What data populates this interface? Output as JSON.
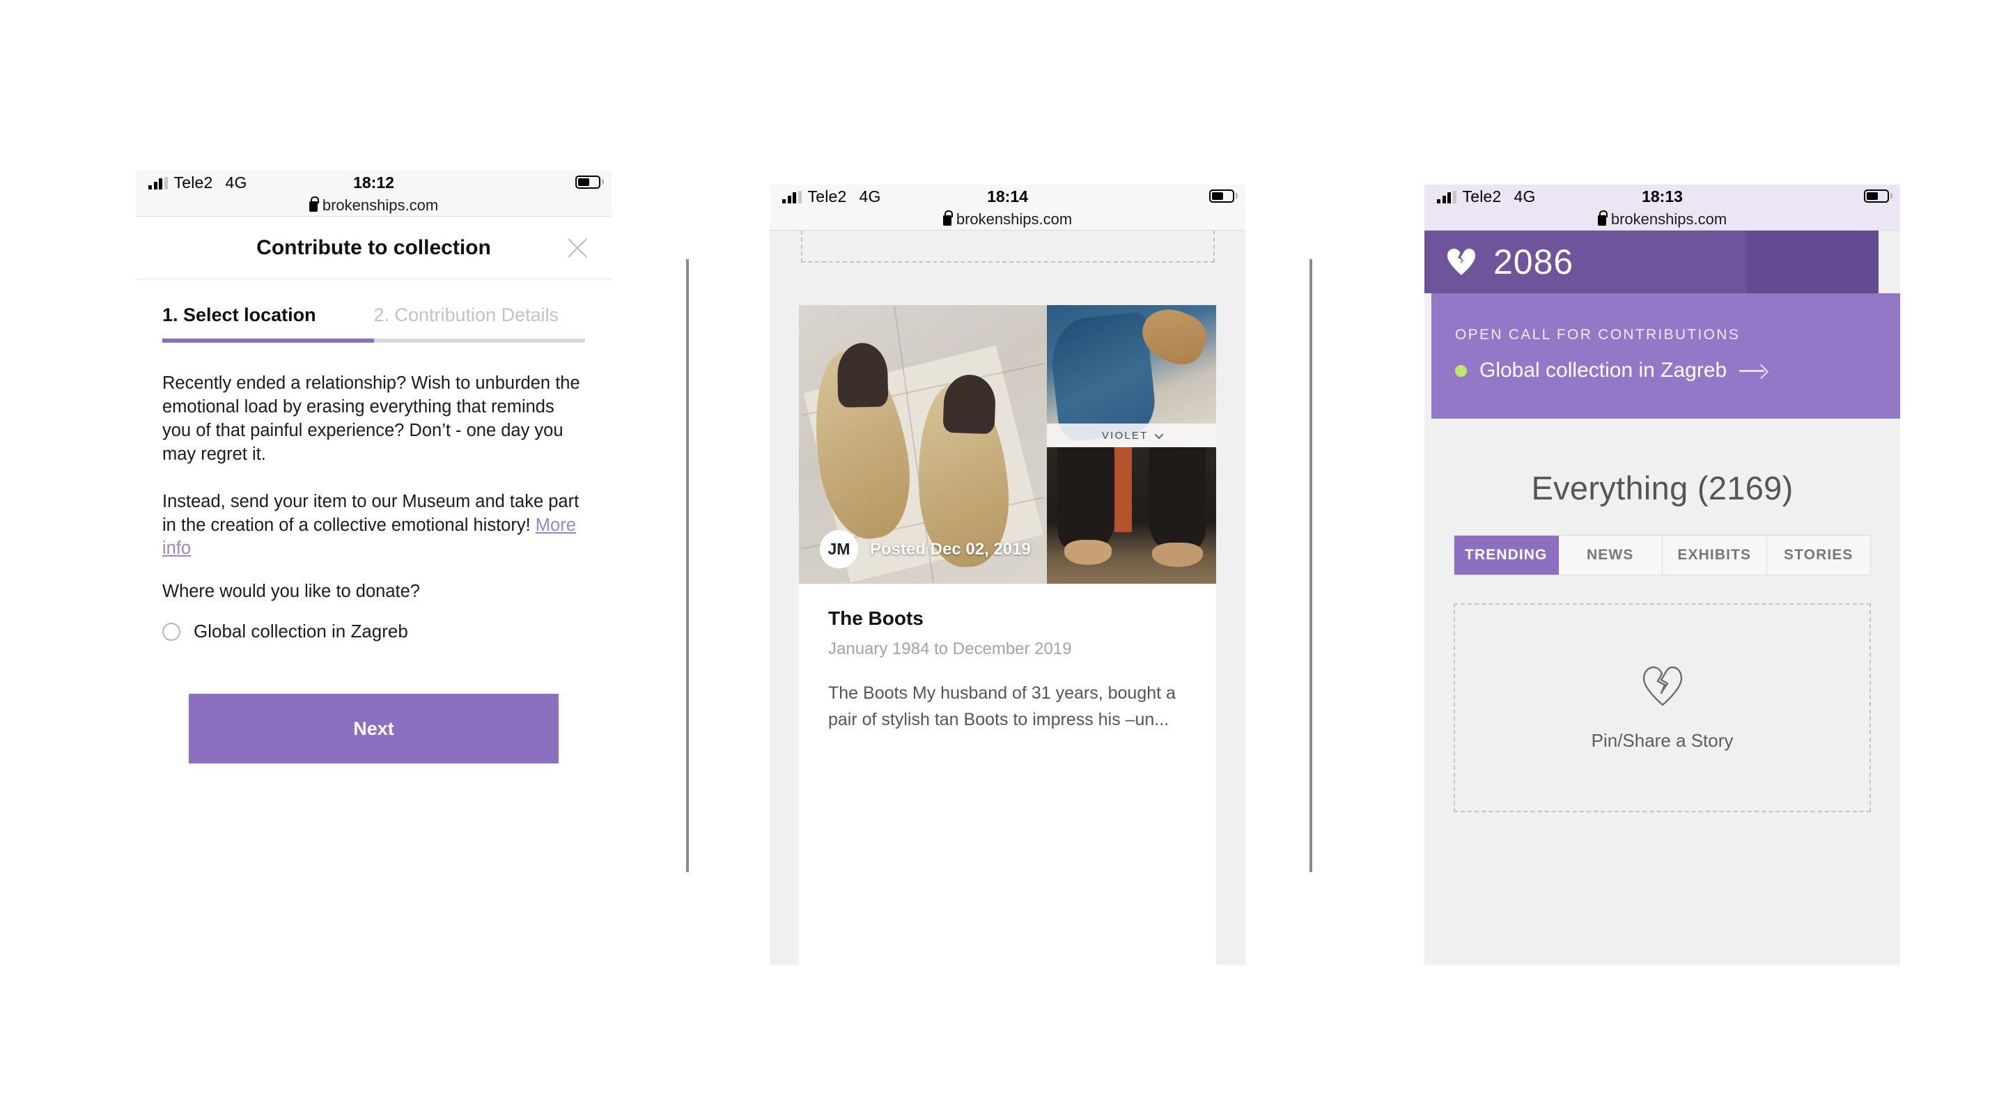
{
  "colors": {
    "accent_purple": "#8d6fc0",
    "header_purple_dark": "#6e549a",
    "header_purple_darker": "#644a90",
    "banner_purple": "#9478c8",
    "link_purple": "#9d82cd",
    "dot_green": "#c2e86a",
    "page_bg": "#f0f0f0"
  },
  "phone1": {
    "statusbar": {
      "carrier": "Tele2",
      "network": "4G",
      "time": "18:12",
      "url": "brokenships.com",
      "lock_icon": "lock-icon",
      "signal_icon": "signal-bars-icon",
      "battery_icon": "battery-icon"
    },
    "header": {
      "title": "Contribute to collection",
      "close_icon": "close-icon"
    },
    "steps": [
      {
        "label": "1. Select location",
        "state": "active"
      },
      {
        "label": "2. Contribution Details",
        "state": "idle"
      }
    ],
    "progress_percent": 50,
    "paragraphs": [
      "Recently ended a relationship? Wish to unburden the emotional load by erasing everything that reminds you of that painful experience? Don’t - one day you may regret it.",
      "Instead, send your item to our Museum and take part in the creation of a collective emotional history! "
    ],
    "more_info_label": "More info",
    "question": "Where would you like to donate?",
    "options": [
      {
        "label": "Global collection in Zagreb",
        "selected": false
      }
    ],
    "next_label": "Next"
  },
  "phone2": {
    "statusbar": {
      "carrier": "Tele2",
      "network": "4G",
      "time": "18:14",
      "url": "brokenships.com",
      "lock_icon": "lock-icon",
      "signal_icon": "signal-bars-icon",
      "battery_icon": "battery-icon"
    },
    "post": {
      "avatar_initials": "JM",
      "posted_label": "Posted Dec 02, 2019",
      "video_play_icon": "play-icon",
      "overlay_caption": "VIOLET",
      "overlay_chevron_icon": "chevron-down-icon",
      "title": "The Boots",
      "dates": "January 1984 to December 2019",
      "excerpt": "The Boots My husband of 31 years, bought a pair of stylish tan Boots to impress his –un...",
      "bottom_glyph": "⚲"
    }
  },
  "phone3": {
    "statusbar": {
      "carrier": "Tele2",
      "network": "4G",
      "time": "18:13",
      "url": "brokenships.com",
      "lock_icon": "lock-icon",
      "signal_icon": "signal-bars-icon",
      "battery_icon": "battery-icon"
    },
    "brand": {
      "logo_icon": "broken-heart-solid-icon",
      "count": "2086"
    },
    "banner": {
      "kicker": "OPEN CALL FOR CONTRIBUTIONS",
      "status_dot_icon": "status-dot-icon",
      "link_label": "Global collection in Zagreb",
      "arrow_icon": "arrow-right-icon"
    },
    "heading": "Everything (2169)",
    "tabs": [
      {
        "label": "TRENDING",
        "active": true
      },
      {
        "label": "NEWS",
        "active": false
      },
      {
        "label": "EXHIBITS",
        "active": false
      },
      {
        "label": "STORIES",
        "active": false
      }
    ],
    "dropzone": {
      "icon": "broken-heart-outline-icon",
      "label": "Pin/Share a Story"
    }
  }
}
